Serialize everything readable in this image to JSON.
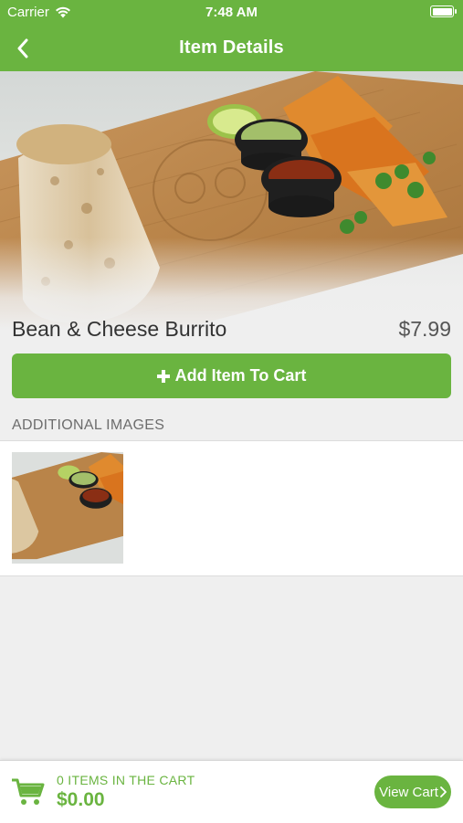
{
  "colors": {
    "accent": "#6ab440"
  },
  "status_bar": {
    "carrier": "Carrier",
    "time": "7:48 AM"
  },
  "header": {
    "title": "Item Details",
    "back_icon": "chevron-left-icon"
  },
  "item": {
    "name": "Bean & Cheese Burrito",
    "price": "$7.99"
  },
  "add_button": {
    "icon": "plus-icon",
    "label": "Add Item To Cart"
  },
  "additional_images": {
    "heading": "ADDITIONAL IMAGES",
    "count": 1
  },
  "cart": {
    "icon": "cart-icon",
    "items_label": "0 ITEMS IN THE CART",
    "total": "$0.00",
    "button_label": "View Cart",
    "button_icon": "chevron-right-icon"
  }
}
